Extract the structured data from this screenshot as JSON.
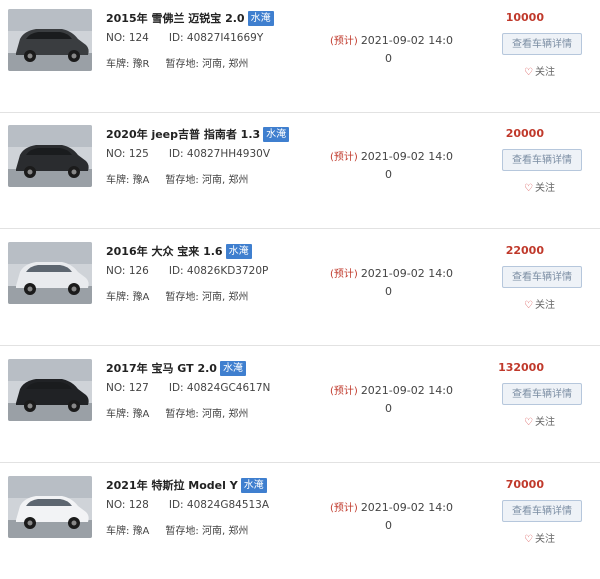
{
  "colors": {
    "price": "#c0392b",
    "badge_bg": "#3f7fcf",
    "button_bg": "#eef2f7",
    "button_border": "#b6c7dc",
    "heart": "#d23a3a"
  },
  "labels": {
    "no_prefix": "NO: ",
    "id_prefix": "ID: ",
    "plate_prefix": "车牌: ",
    "storage_prefix": "暂存地: ",
    "forecast_tag": "(预计)",
    "detail_button": "查看车辆详情",
    "follow": "关注",
    "follow_icon": "heart-outline-icon"
  },
  "cars": [
    {
      "title": "2015年 雪佛兰 迈锐宝 2.0",
      "badge": "水淹",
      "no": "124",
      "id": "40827I41669Y",
      "plate": "豫R",
      "storage": "河南, 郑州",
      "forecast_time": "2021-09-02 14:0",
      "count": "0",
      "price": "10000",
      "photo": "dark-sedan-photo",
      "car_color": "#3a3d40"
    },
    {
      "title": "2020年 jeep吉普 指南者 1.3",
      "badge": "水淹",
      "no": "125",
      "id": "40827HH4930V",
      "plate": "豫A",
      "storage": "河南, 郑州",
      "forecast_time": "2021-09-02 14:0",
      "count": "0",
      "price": "20000",
      "photo": "dark-suv-photo",
      "car_color": "#2a2c2f"
    },
    {
      "title": "2016年 大众 宝来 1.6",
      "badge": "水淹",
      "no": "126",
      "id": "40826KD3720P",
      "plate": "豫A",
      "storage": "河南, 郑州",
      "forecast_time": "2021-09-02 14:0",
      "count": "0",
      "price": "22000",
      "photo": "white-sedan-photo",
      "car_color": "#e9ebee"
    },
    {
      "title": "2017年 宝马 GT 2.0",
      "badge": "水淹",
      "no": "127",
      "id": "40824GC4617N",
      "plate": "豫A",
      "storage": "河南, 郑州",
      "forecast_time": "2021-09-02 14:0",
      "count": "0",
      "price": "132000",
      "photo": "black-bmw-photo",
      "car_color": "#202225"
    },
    {
      "title": "2021年 特斯拉 Model Y",
      "badge": "水淹",
      "no": "128",
      "id": "40824G84513A",
      "plate": "豫A",
      "storage": "河南, 郑州",
      "forecast_time": "2021-09-02 14:0",
      "count": "0",
      "price": "70000",
      "photo": "white-tesla-photo",
      "car_color": "#f2f3f5"
    }
  ]
}
